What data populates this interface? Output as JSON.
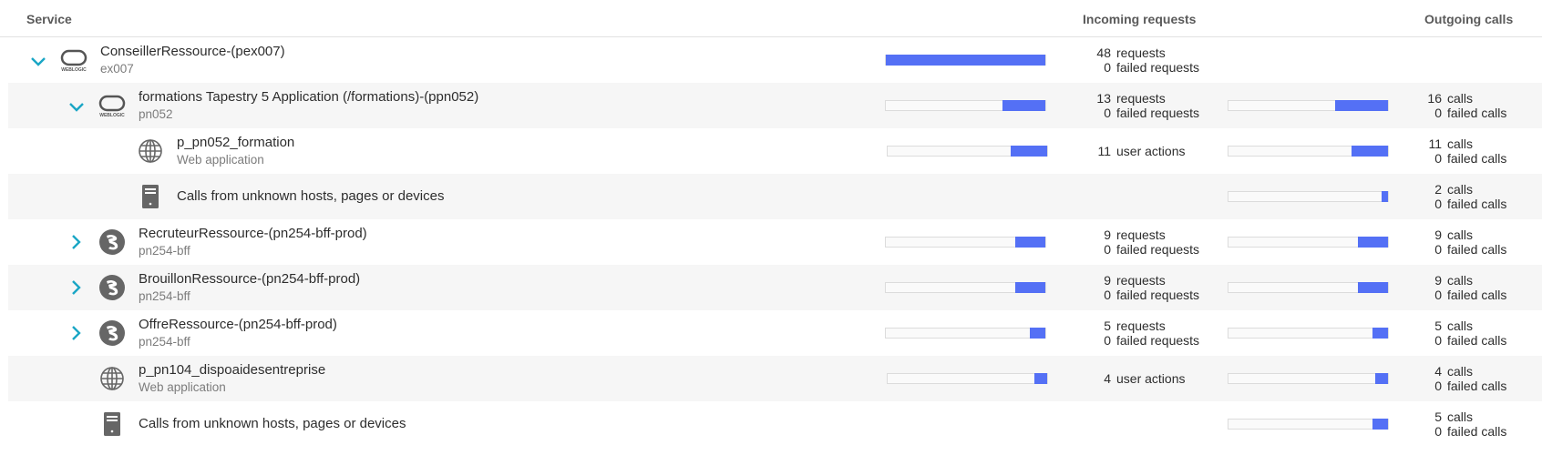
{
  "header": {
    "service": "Service",
    "incoming": "Incoming requests",
    "outgoing": "Outgoing calls"
  },
  "colors": {
    "bar": "#5470f5",
    "chevron": "#1aa6c5",
    "alt_row": "#f6f6f6"
  },
  "rows": [
    {
      "name": "ConseillerRessource-(pex007)",
      "sub": "ex007",
      "icon": "weblogic-icon",
      "expanded": true,
      "in_num1": "48",
      "in_label1": "requests",
      "in_num2": "0",
      "in_label2": "failed requests",
      "in_fill": 1.0
    },
    {
      "name": "formations Tapestry 5 Application (/formations)-(ppn052)",
      "sub": "pn052",
      "icon": "weblogic-icon",
      "expanded": true,
      "in_num1": "13",
      "in_label1": "requests",
      "in_num2": "0",
      "in_label2": "failed requests",
      "in_fill": 0.27,
      "out_num1": "16",
      "out_label1": "calls",
      "out_num2": "0",
      "out_label2": "failed calls",
      "out_fill": 0.33
    },
    {
      "name": "p_pn052_formation",
      "sub": "Web application",
      "icon": "globe-icon",
      "in_num1": "11",
      "in_label1": "user actions",
      "in_fill": 0.23,
      "out_num1": "11",
      "out_label1": "calls",
      "out_num2": "0",
      "out_label2": "failed calls",
      "out_fill": 0.23
    },
    {
      "name": "Calls from unknown hosts, pages or devices",
      "icon": "server-icon",
      "out_num1": "2",
      "out_label1": "calls",
      "out_num2": "0",
      "out_label2": "failed calls",
      "out_fill": 0.04
    },
    {
      "name": "RecruteurRessource-(pn254-bff-prod)",
      "sub": "pn254-bff",
      "icon": "nodejs-icon",
      "expanded": false,
      "in_num1": "9",
      "in_label1": "requests",
      "in_num2": "0",
      "in_label2": "failed requests",
      "in_fill": 0.19,
      "out_num1": "9",
      "out_label1": "calls",
      "out_num2": "0",
      "out_label2": "failed calls",
      "out_fill": 0.19
    },
    {
      "name": "BrouillonRessource-(pn254-bff-prod)",
      "sub": "pn254-bff",
      "icon": "nodejs-icon",
      "expanded": false,
      "in_num1": "9",
      "in_label1": "requests",
      "in_num2": "0",
      "in_label2": "failed requests",
      "in_fill": 0.19,
      "out_num1": "9",
      "out_label1": "calls",
      "out_num2": "0",
      "out_label2": "failed calls",
      "out_fill": 0.19
    },
    {
      "name": "OffreRessource-(pn254-bff-prod)",
      "sub": "pn254-bff",
      "icon": "nodejs-icon",
      "expanded": false,
      "in_num1": "5",
      "in_label1": "requests",
      "in_num2": "0",
      "in_label2": "failed requests",
      "in_fill": 0.1,
      "out_num1": "5",
      "out_label1": "calls",
      "out_num2": "0",
      "out_label2": "failed calls",
      "out_fill": 0.1
    },
    {
      "name": "p_pn104_dispoaidesentreprise",
      "sub": "Web application",
      "icon": "globe-icon",
      "in_num1": "4",
      "in_label1": "user actions",
      "in_fill": 0.08,
      "out_num1": "4",
      "out_label1": "calls",
      "out_num2": "0",
      "out_label2": "failed calls",
      "out_fill": 0.08
    },
    {
      "name": "Calls from unknown hosts, pages or devices",
      "icon": "server-icon",
      "out_num1": "5",
      "out_label1": "calls",
      "out_num2": "0",
      "out_label2": "failed calls",
      "out_fill": 0.1
    }
  ]
}
